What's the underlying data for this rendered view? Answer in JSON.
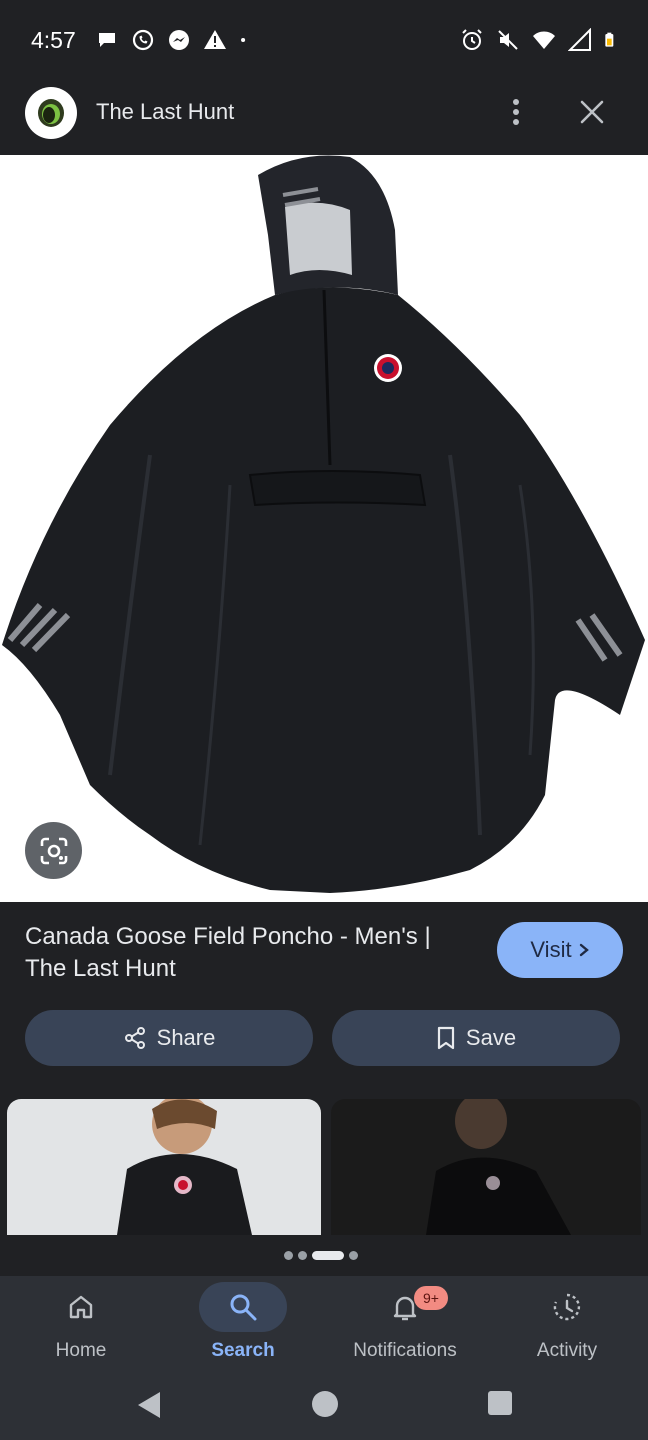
{
  "status_bar": {
    "time": "4:57",
    "left_icons": [
      "chat-bubble-icon",
      "whatsapp-icon",
      "messenger-icon",
      "alert-icon",
      "dot-icon"
    ],
    "right_icons": [
      "alarm-icon",
      "mute-icon",
      "wifi-icon",
      "signal-icon",
      "battery-icon"
    ]
  },
  "header": {
    "site_name": "The Last Hunt"
  },
  "product": {
    "title": "Canada Goose Field Poncho - Men's | The Last Hunt",
    "visit_label": "Visit",
    "share_label": "Share",
    "save_label": "Save"
  },
  "carousel": {
    "page_count": 4,
    "active_index": 2
  },
  "bottom_nav": {
    "items": [
      {
        "label": "Home",
        "icon": "home-icon"
      },
      {
        "label": "Search",
        "icon": "search-icon",
        "active": true
      },
      {
        "label": "Notifications",
        "icon": "bell-icon",
        "badge": "9+"
      },
      {
        "label": "Activity",
        "icon": "activity-icon"
      }
    ]
  },
  "colors": {
    "background": "#202124",
    "accent": "#8ab4f8",
    "button_bg": "#394457",
    "badge": "#f28b82"
  }
}
